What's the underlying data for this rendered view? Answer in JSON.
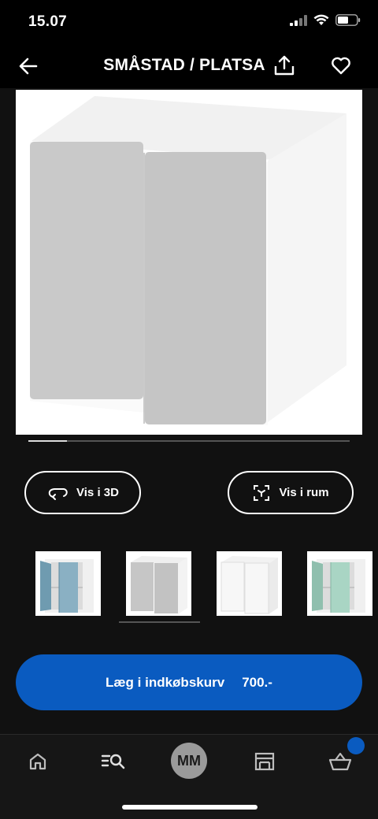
{
  "status_bar": {
    "time": "15.07"
  },
  "header": {
    "title": "SMÅSTAD / PLATSA"
  },
  "gallery": {
    "progress": 0.12
  },
  "actions": {
    "view_3d_label": "Vis i 3D",
    "view_room_label": "Vis i rum"
  },
  "variants": [
    {
      "name": "blue"
    },
    {
      "name": "grey"
    },
    {
      "name": "white"
    },
    {
      "name": "mint"
    }
  ],
  "cart": {
    "label": "Læg i indkøbskurv",
    "price": "700.-"
  },
  "bottom_nav": {
    "avatar_initials": "MM"
  },
  "colors": {
    "accent": "#0a5bc0",
    "background": "#111111",
    "door_grey": "#c9c9c9"
  }
}
